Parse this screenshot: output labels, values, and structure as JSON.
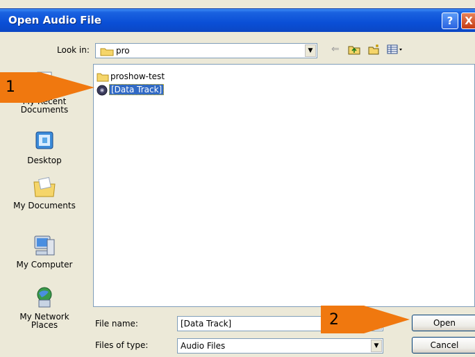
{
  "window": {
    "title": "Open Audio File",
    "help_label": "?",
    "close_label": "X"
  },
  "look_in": {
    "label": "Look in:",
    "value": "pro"
  },
  "toolbar": {
    "back_icon": "back-arrow-icon",
    "up_icon": "up-folder-icon",
    "new_folder_icon": "new-folder-icon",
    "views_icon": "views-menu-icon"
  },
  "places": [
    {
      "label": "My Recent\nDocuments",
      "icon": "recent-documents-icon"
    },
    {
      "label": "Desktop",
      "icon": "desktop-icon"
    },
    {
      "label": "My Documents",
      "icon": "my-documents-icon"
    },
    {
      "label": "My Computer",
      "icon": "my-computer-icon"
    },
    {
      "label": "My Network\nPlaces",
      "icon": "network-places-icon"
    }
  ],
  "files": [
    {
      "name": "proshow-test",
      "type": "folder"
    },
    {
      "name": "[Data Track]",
      "type": "disc-track",
      "selected": true
    }
  ],
  "file_name": {
    "label": "File name:",
    "value": "[Data Track]"
  },
  "file_type": {
    "label": "Files of type:",
    "value": "Audio Files"
  },
  "buttons": {
    "open": "Open",
    "cancel": "Cancel"
  },
  "callouts": [
    {
      "number": "1"
    },
    {
      "number": "2"
    }
  ],
  "colors": {
    "titlebar": "#0a4fd6",
    "selection": "#316ac5",
    "callout_arrow": "#f0780f",
    "dialog_bg": "#ece9d8"
  }
}
